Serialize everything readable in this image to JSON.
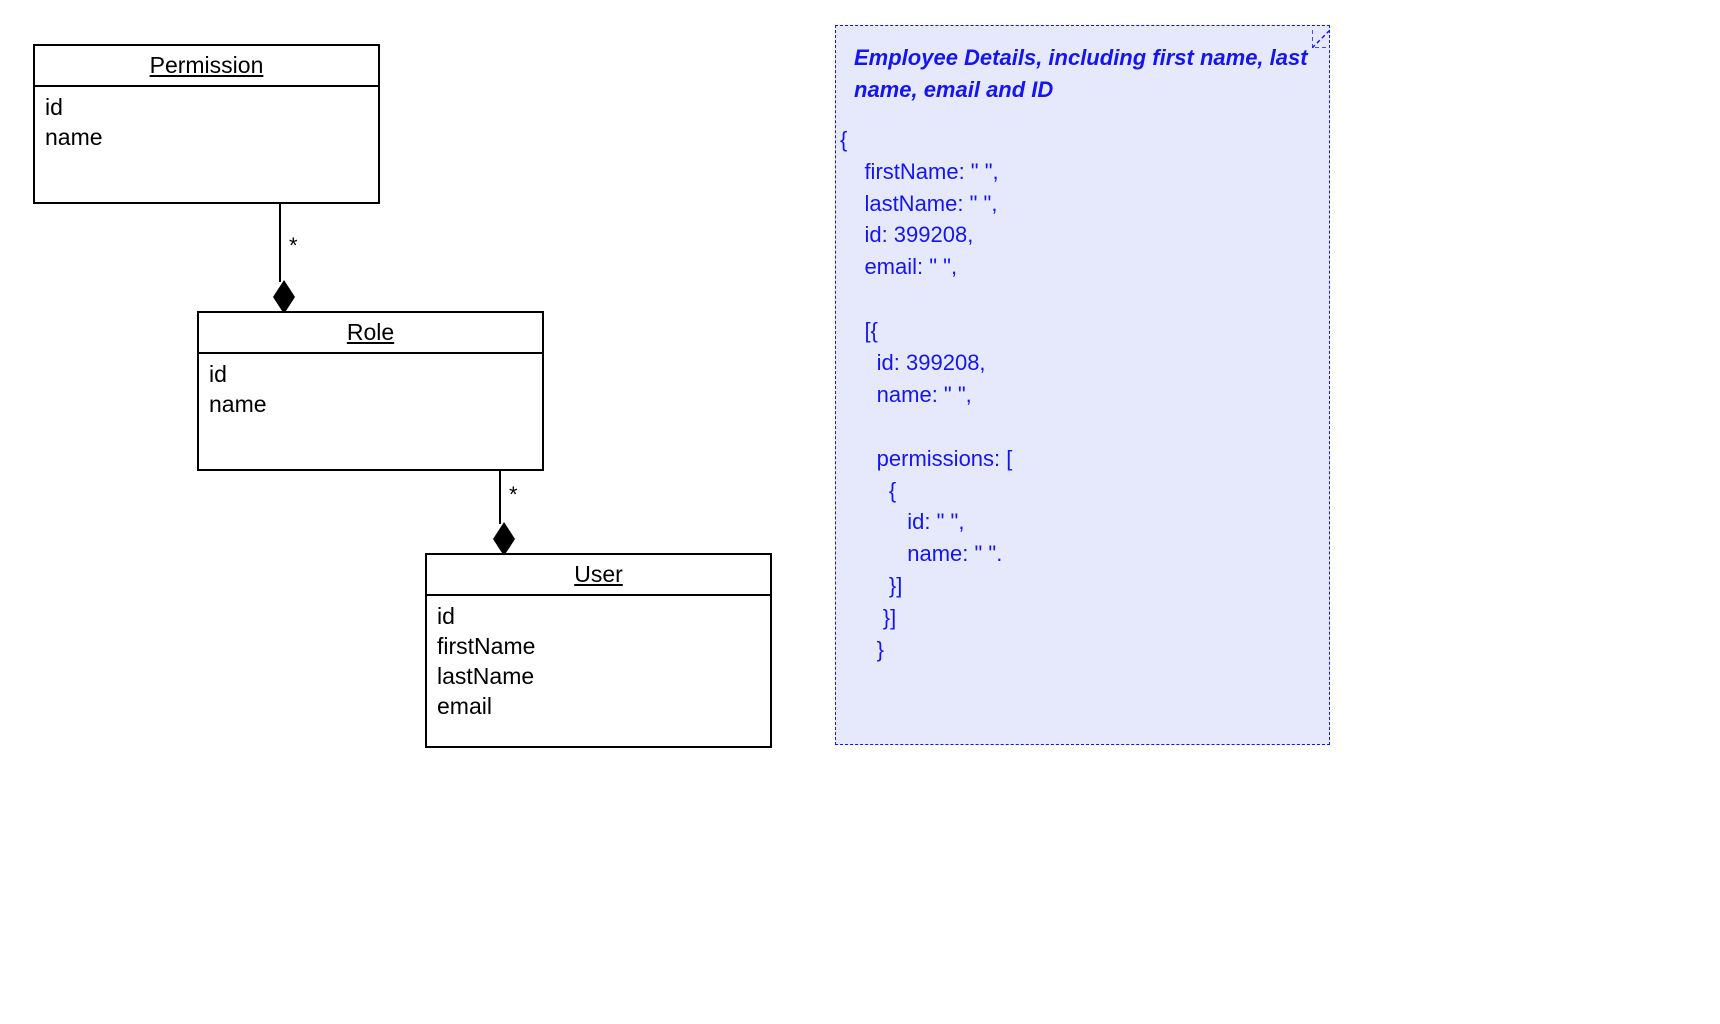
{
  "classes": {
    "permission": {
      "name": "Permission",
      "attr1": "id",
      "attr2": "name"
    },
    "role": {
      "name": "Role",
      "attr1": "id",
      "attr2": "name"
    },
    "user": {
      "name": "User",
      "attr1": "id",
      "attr2": "firstName",
      "attr3": "lastName",
      "attr4": "email"
    }
  },
  "multiplicities": {
    "permRole": "*",
    "roleUser": "*"
  },
  "note": {
    "title": "Employee Details, including first name, last name, email and ID",
    "body": "{\n    firstName: \" \",\n    lastName: \" \",\n    id: 399208,\n    email: \" \",\n\n    [{\n      id: 399208,\n      name: \" \",\n\n      permissions: [\n        {\n           id: \" \",\n           name: \" \".\n        }]\n       }]\n      }"
  }
}
